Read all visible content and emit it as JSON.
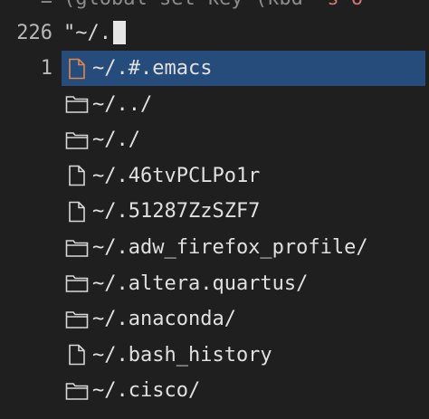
{
  "top_partial": {
    "text": "(global-set-key (kbd",
    "tail": "\"s-o\""
  },
  "editor": {
    "line_current": "226",
    "line_current_text": "\"~/.",
    "line_relative": "1"
  },
  "completions": [
    {
      "label": "~/.#.emacs",
      "icon": "file-icon",
      "selected": true
    },
    {
      "label": "~/../",
      "icon": "folder-icon",
      "selected": false
    },
    {
      "label": "~/./",
      "icon": "folder-icon",
      "selected": false
    },
    {
      "label": "~/.46tvPCLPo1r",
      "icon": "file-icon",
      "selected": false
    },
    {
      "label": "~/.51287ZzSZF7",
      "icon": "file-icon",
      "selected": false
    },
    {
      "label": "~/.adw_firefox_profile/",
      "icon": "folder-icon",
      "selected": false
    },
    {
      "label": "~/.altera.quartus/",
      "icon": "folder-icon",
      "selected": false
    },
    {
      "label": "~/.anaconda/",
      "icon": "folder-icon",
      "selected": false
    },
    {
      "label": "~/.bash_history",
      "icon": "file-icon",
      "selected": false
    },
    {
      "label": "~/.cisco/",
      "icon": "folder-icon",
      "selected": false
    }
  ],
  "colors": {
    "background": "#1f1f1f",
    "selection": "#254c7a",
    "selected_icon": "#e0884a",
    "icon": "#d8d8d8"
  }
}
